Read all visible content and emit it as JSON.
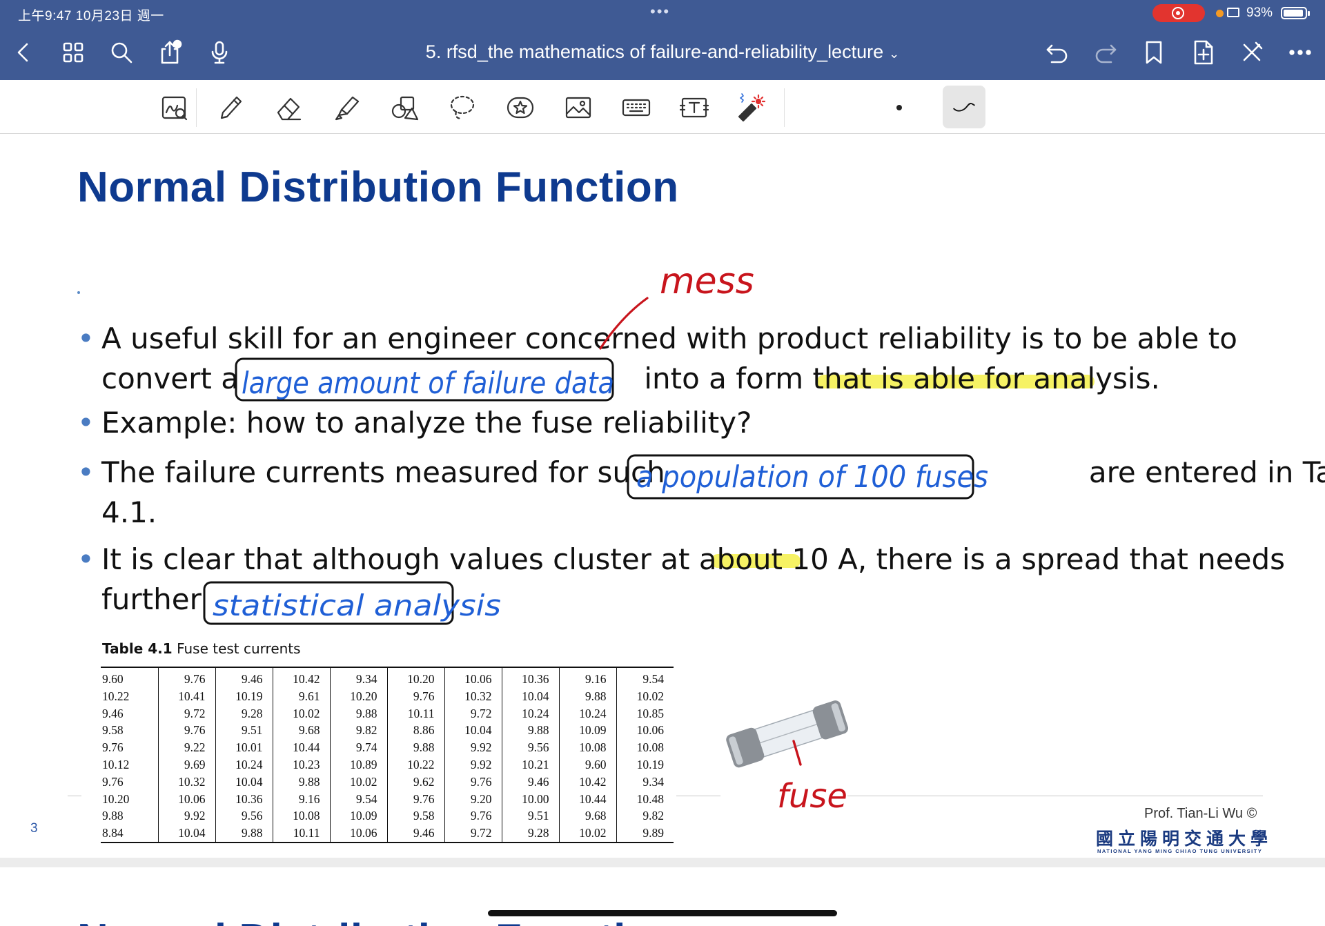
{
  "status_bar": {
    "time": "上午9:47   10月23日 週一",
    "dots": "•••",
    "battery_text": "93%",
    "battery_level": 0.93
  },
  "nav": {
    "document_title": "5. rfsd_the mathematics of failure-and-reliability_lecture",
    "title_chevron": "⌄"
  },
  "slide": {
    "title": "Normal Distribution Function",
    "bullets": [
      {
        "line1": "A useful skill for an engineer concerned with product reliability is to be able to",
        "line2": "convert a                                            into a form that is able for analysis."
      },
      {
        "line1": "Example: how to analyze the fuse reliability?",
        "line2": ""
      },
      {
        "line1": "The failure currents measured for such                                              are entered in Table",
        "line2": "4.1."
      },
      {
        "line1": "It is clear that although values cluster at about 10 A, there is a spread that needs",
        "line2": "further"
      }
    ],
    "bullet_glyph": "•",
    "table_caption_label": "Table 4.1",
    "table_caption_text": "Fuse test currents",
    "table_rows": [
      [
        "9.60",
        "9.76",
        "9.46",
        "10.42",
        "9.34",
        "10.20",
        "10.06",
        "10.36",
        "9.16",
        "9.54"
      ],
      [
        "10.22",
        "10.41",
        "10.19",
        "9.61",
        "10.20",
        "9.76",
        "10.32",
        "10.04",
        "9.88",
        "10.02"
      ],
      [
        "9.46",
        "9.72",
        "9.28",
        "10.02",
        "9.88",
        "10.11",
        "9.72",
        "10.24",
        "10.24",
        "10.85"
      ],
      [
        "9.58",
        "9.76",
        "9.51",
        "9.68",
        "9.82",
        "8.86",
        "10.04",
        "9.88",
        "10.09",
        "10.06"
      ],
      [
        "9.76",
        "9.22",
        "10.01",
        "10.44",
        "9.74",
        "9.88",
        "9.92",
        "9.56",
        "10.08",
        "10.08"
      ],
      [
        "10.12",
        "9.69",
        "10.24",
        "10.23",
        "10.89",
        "10.22",
        "9.92",
        "10.21",
        "9.60",
        "10.19"
      ],
      [
        "9.76",
        "10.32",
        "10.04",
        "9.88",
        "10.02",
        "9.62",
        "9.76",
        "9.46",
        "10.42",
        "9.34"
      ],
      [
        "10.20",
        "10.06",
        "10.36",
        "9.16",
        "9.54",
        "9.76",
        "9.20",
        "10.00",
        "10.44",
        "10.48"
      ],
      [
        "9.88",
        "9.92",
        "9.56",
        "10.08",
        "10.09",
        "9.58",
        "9.76",
        "9.51",
        "9.68",
        "9.82"
      ],
      [
        "8.84",
        "10.04",
        "9.88",
        "10.11",
        "10.06",
        "9.46",
        "9.72",
        "9.28",
        "10.02",
        "9.89"
      ]
    ],
    "page_number": "3",
    "professor": "Prof. Tian-Li Wu ©",
    "university_cn": "國立陽明交通大學",
    "university_en": "NATIONAL YANG MING CHIAO TUNG UNIVERSITY",
    "next_slide_title": "Normal Distribution Function"
  },
  "annotations": {
    "mess": "mess",
    "large_amount": "large amount of failure data",
    "population": "a population of 100 fuses",
    "statistical": "statistical analysis",
    "fuse": "fuse",
    "ink_blue": "#1f5fd6",
    "ink_red": "#c8141c",
    "highlight": "#f5f04a"
  },
  "colors": {
    "app_bar": "#3f5a94",
    "title_blue": "#0e3a8f",
    "bullet_blue": "#4a7cc2"
  },
  "icons": [
    "back-icon",
    "grid-icon",
    "search-icon",
    "share-icon",
    "microphone-icon",
    "undo-icon",
    "redo-icon",
    "bookmark-icon",
    "add-page-icon",
    "close-icon",
    "more-icon",
    "zoom-window-icon",
    "pen-icon",
    "eraser-icon",
    "highlighter-icon",
    "shapes-icon",
    "lasso-icon",
    "sticker-icon",
    "image-icon",
    "keyboard-icon",
    "textbox-icon",
    "laser-pointer-icon"
  ]
}
